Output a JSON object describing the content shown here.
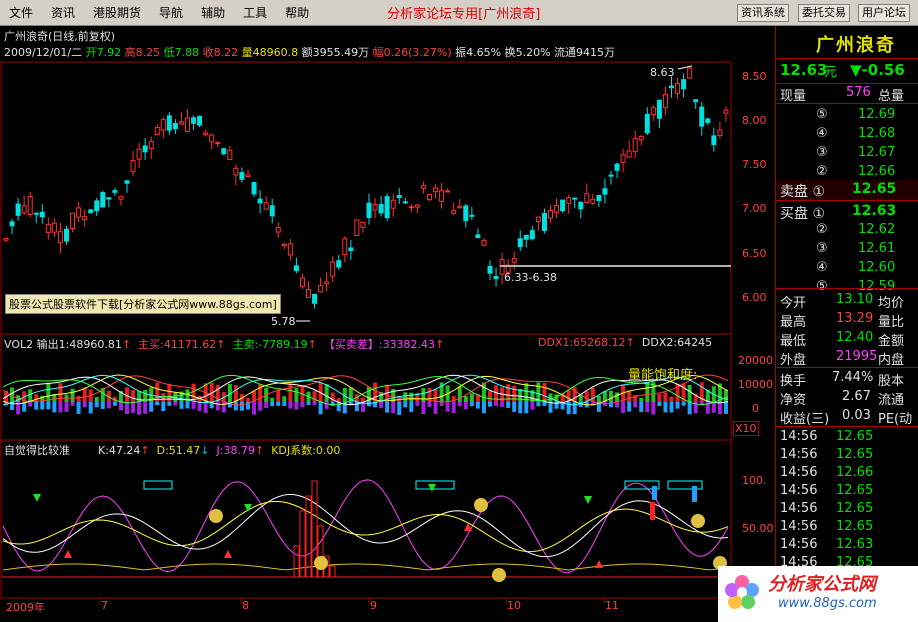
{
  "menu": {
    "items": [
      "文件",
      "资讯",
      "港股期货",
      "导航",
      "辅助",
      "工具",
      "帮助"
    ],
    "title": "分析家论坛专用",
    "stock_tag": "[广州浪奇]",
    "buttons": [
      "资讯系统",
      "委托交易",
      "用户论坛"
    ]
  },
  "header": {
    "name": "广州浪奇(日线,前复权)",
    "date": "2009/12/01/二",
    "open": "开7.92",
    "high": "高8.25",
    "low": "低7.88",
    "close": "收8.22",
    "volume": "量48960.8",
    "amount": "额3955.49万",
    "change": "幅0.26(3.27%)",
    "amplitude": "振4.65%",
    "turnover": "换5.20%",
    "float": "流通9415万"
  },
  "price_axis": [
    "8.50",
    "8.00",
    "7.50",
    "7.00",
    "6.50",
    "6.00"
  ],
  "annotations": {
    "high": "8.63",
    "low": "5.78",
    "range": "6.33-6.38",
    "ad": "股票公式股票软件下载[分析家公式网www.88gs.com]"
  },
  "vol_panel": {
    "label": "VOL2",
    "out1": "输出1:48960.81",
    "buy": "主买:41171.62",
    "sell": "主卖:-7789.19",
    "bs": "【买卖差】:33382.43",
    "ddx1": "DDX1:65268.12",
    "ddx2": "DDX2:64245",
    "saturation": "量能饱和度:",
    "axis": [
      "20000",
      "10000",
      "0"
    ],
    "x10": "X10"
  },
  "kdj_panel": {
    "label": "自觉得比较准",
    "k": "K:47.24",
    "d": "D:51.47",
    "j": "J:38.79",
    "coef": "KDJ系数:0.00",
    "axis": [
      "100.",
      "50.00"
    ]
  },
  "date_axis": [
    "2009年",
    "7",
    "8",
    "9",
    "10",
    "11"
  ],
  "quote": {
    "name": "广州浪奇",
    "price": "12.63",
    "unit": "元",
    "change": "▼-0.56",
    "now_vol_label": "现量",
    "now_vol": "576",
    "total_label": "总量",
    "asks": [
      {
        "l": "⑤",
        "p": "12.69"
      },
      {
        "l": "④",
        "p": "12.68"
      },
      {
        "l": "③",
        "p": "12.67"
      },
      {
        "l": "②",
        "p": "12.66"
      }
    ],
    "ask1_label": "卖盘 ①",
    "ask1": "12.65",
    "bid1_label": "买盘 ①",
    "bid1": "12.63",
    "bids": [
      {
        "l": "②",
        "p": "12.62"
      },
      {
        "l": "③",
        "p": "12.61"
      },
      {
        "l": "④",
        "p": "12.60"
      },
      {
        "l": "⑤",
        "p": "12.59"
      }
    ],
    "stats": [
      {
        "a": "今开",
        "v": "13.10",
        "b": "均价"
      },
      {
        "a": "最高",
        "v": "13.29",
        "b": "量比"
      },
      {
        "a": "最低",
        "v": "12.40",
        "b": "金额"
      },
      {
        "a": "外盘",
        "v": "21995",
        "b": "内盘"
      }
    ],
    "stats2": [
      {
        "a": "换手",
        "v": "7.44%",
        "b": "股本"
      },
      {
        "a": "净资",
        "v": "2.67",
        "b": "流通"
      },
      {
        "a": "收益(三)",
        "v": "0.03",
        "b": "PE(动"
      }
    ],
    "ticks": [
      {
        "t": "14:56",
        "p": "12.65"
      },
      {
        "t": "14:56",
        "p": "12.65"
      },
      {
        "t": "14:56",
        "p": "12.66"
      },
      {
        "t": "14:56",
        "p": "12.65"
      },
      {
        "t": "14:56",
        "p": "12.65"
      },
      {
        "t": "14:56",
        "p": "12.65"
      },
      {
        "t": "14:56",
        "p": "12.63"
      },
      {
        "t": "14:56",
        "p": "12.65"
      }
    ],
    "logo": "分析家公式网",
    "logo_url": "www.88gs.com"
  }
}
